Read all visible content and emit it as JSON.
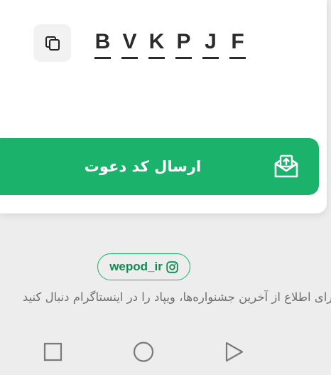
{
  "invite": {
    "code_chars": [
      "B",
      "V",
      "K",
      "P",
      "J",
      "F"
    ],
    "copy_icon": "copy-icon",
    "send_button_label": "ارسال کد دعوت",
    "send_icon": "envelope-upload-icon"
  },
  "social": {
    "instagram_handle": "wepod_ir",
    "instagram_icon": "instagram-icon",
    "follow_text": "برای اطلاع از آخرین جشنواره‌ها، ویپاد را در اینستاگرام دنبال کنید"
  },
  "colors": {
    "accent": "#1bb36b",
    "text_dark": "#2b2b2b",
    "muted": "#6f6f6f",
    "background": "#ededed"
  },
  "system_nav": {
    "icons": [
      "recents-square-icon",
      "home-circle-icon",
      "back-triangle-icon"
    ]
  }
}
